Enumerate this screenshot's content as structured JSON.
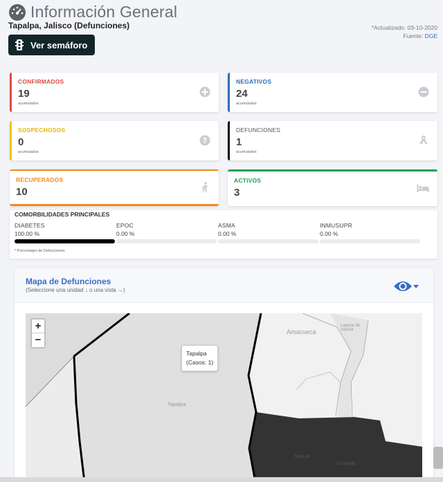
{
  "header": {
    "title": "Información General",
    "subtitle": "Tapalpa, Jalisco (Defunciones)",
    "updated": "*Actualizado: 03-10-2020",
    "source_label": "Fuente:",
    "source_value": "DGE",
    "semaforo_button": "Ver semáforo"
  },
  "cards": {
    "confirmados": {
      "label": "CONFIRMADOS",
      "value": "19",
      "sub": "acumulados",
      "color": "#e04c44",
      "icon": "plus-circle-icon"
    },
    "negativos": {
      "label": "NEGATIVOS",
      "value": "24",
      "sub": "acumulados",
      "color": "#2f6fb0",
      "icon": "minus-circle-icon"
    },
    "sospechosos": {
      "label": "SOSPECHOSOS",
      "value": "0",
      "sub": "acumulados",
      "color": "#f0c419",
      "icon": "question-circle-icon"
    },
    "defunciones": {
      "label": "DEFUNCIONES",
      "value": "1",
      "sub": "acumulados",
      "color": "#111111",
      "icon": "ribbon-icon"
    },
    "recuperados": {
      "label": "RECUPERADOS",
      "value": "10",
      "color": "#ef8a1f",
      "icon": "walking-person-icon"
    },
    "activos": {
      "label": "ACTIVOS",
      "value": "3",
      "color": "#22a052",
      "icon": "bed-icon"
    }
  },
  "comorbilidades": {
    "title": "COMORBILIDADES PRINCIPALES",
    "note": "* Porcentajes de Defunciones",
    "items": [
      {
        "name": "DIABETES",
        "pct_label": "100.00 %",
        "pct": 100
      },
      {
        "name": "EPOC",
        "pct_label": "0.00 %",
        "pct": 0
      },
      {
        "name": "ASMA",
        "pct_label": "0.00 %",
        "pct": 0
      },
      {
        "name": "INMUSUPR",
        "pct_label": "0.00 %",
        "pct": 0
      }
    ]
  },
  "map": {
    "title": "Mapa de Defunciones",
    "subtitle": "(Seleccione una unidad ↓ o una vista →)",
    "zoom_in": "+",
    "zoom_out": "−",
    "tooltip_name": "Tapalpa",
    "tooltip_cases": "(Casos: 1)",
    "labels": {
      "amacueca": "Amacueca",
      "tapalpa": "Tapalpa",
      "sayula": "Laguna de Sayula",
      "sayula_town": "Sayula",
      "usmajac": "Usmajac"
    }
  }
}
